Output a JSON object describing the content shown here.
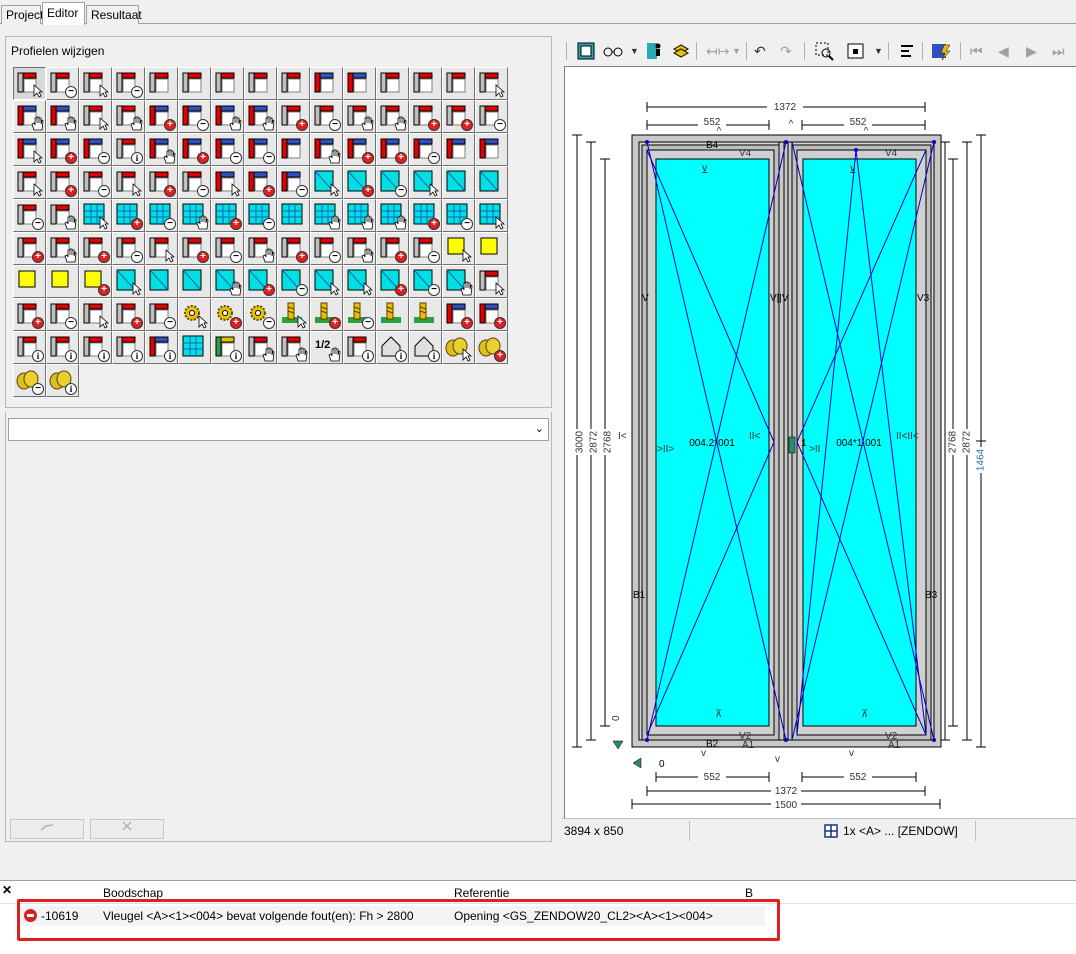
{
  "tabs": [
    {
      "label": "Project",
      "active": false
    },
    {
      "label": "Editor",
      "active": true
    },
    {
      "label": "Resultaat",
      "active": false
    }
  ],
  "left_panel": {
    "title": "Profielen wijzigen",
    "dropdown_value": "",
    "buttons": [
      {
        "icon": "frame-corner-select-icon",
        "badge": "",
        "pointer": true
      },
      {
        "icon": "frame-corner-remove-icon",
        "badge": "minus"
      },
      {
        "icon": "frame-top-select-icon",
        "badge": "",
        "pointer": true
      },
      {
        "icon": "frame-bar-remove-icon",
        "badge": "minus"
      },
      {
        "icon": "profile-edit-icon",
        "badge": ""
      },
      {
        "icon": "profile-type-p-icon",
        "badge": ""
      },
      {
        "icon": "profile-type-p2-icon",
        "badge": ""
      },
      {
        "icon": "profile-type-d-icon",
        "badge": ""
      },
      {
        "icon": "profile-type-e-icon",
        "badge": ""
      },
      {
        "icon": "profile-edit-red-icon",
        "badge": ""
      },
      {
        "icon": "profile-edit-red2-icon",
        "badge": ""
      },
      {
        "icon": "profile-type-v-icon",
        "badge": ""
      },
      {
        "icon": "profile-type-v2-icon",
        "badge": ""
      },
      {
        "icon": "profile-frame-icon",
        "badge": ""
      },
      {
        "icon": "profile-stretch-icon",
        "badge": "",
        "pointer": true
      },
      {
        "icon": "mullion-hand-icon",
        "badge": "",
        "hand": true
      },
      {
        "icon": "mullion-hand2-icon",
        "badge": "",
        "hand": true
      },
      {
        "icon": "diagonal-select-icon",
        "badge": "",
        "pointer": true
      },
      {
        "icon": "diagonal-hand-icon",
        "badge": "",
        "hand": true
      },
      {
        "icon": "sash-add-icon",
        "badge": "plus"
      },
      {
        "icon": "sash-remove-icon",
        "badge": "minus"
      },
      {
        "icon": "mullion-hand3-icon",
        "badge": "",
        "hand": true
      },
      {
        "icon": "mullion-hand4-icon",
        "badge": "",
        "hand": true
      },
      {
        "icon": "transom-add-icon",
        "badge": "plus"
      },
      {
        "icon": "transom-remove-icon",
        "badge": "minus"
      },
      {
        "icon": "transom-hand-icon",
        "badge": "",
        "hand": true
      },
      {
        "icon": "transom-hand2-icon",
        "badge": "",
        "hand": true
      },
      {
        "icon": "bar-add-icon",
        "badge": "plus"
      },
      {
        "icon": "bar-add2-icon",
        "badge": "plus"
      },
      {
        "icon": "bar-remove-icon",
        "badge": "minus"
      },
      {
        "icon": "red-profile-select-icon",
        "badge": "",
        "pointer": true
      },
      {
        "icon": "red-profile-add-icon",
        "badge": "plus"
      },
      {
        "icon": "red-profile-remove-icon",
        "badge": "minus"
      },
      {
        "icon": "arc-info-icon",
        "badge": "info"
      },
      {
        "icon": "dim-x-hand-icon",
        "badge": "",
        "hand": true
      },
      {
        "icon": "dim-x-add-icon",
        "badge": "plus"
      },
      {
        "icon": "dim-x-remove-icon",
        "badge": "minus"
      },
      {
        "icon": "dim-x-minus2-icon",
        "badge": "minus"
      },
      {
        "icon": "dim-x-lock-icon",
        "badge": ""
      },
      {
        "icon": "dim-v-hand-icon",
        "badge": "",
        "hand": true
      },
      {
        "icon": "dim-v-add-icon",
        "badge": "plus"
      },
      {
        "icon": "dim-v-add2-icon",
        "badge": "plus"
      },
      {
        "icon": "dim-v-remove-icon",
        "badge": "minus"
      },
      {
        "icon": "dim-v-lock-icon",
        "badge": ""
      },
      {
        "icon": "dim-v-lock2-icon",
        "badge": ""
      },
      {
        "icon": "frame-copy-select-icon",
        "badge": "",
        "pointer": true
      },
      {
        "icon": "frame-copy-add-icon",
        "badge": "plus"
      },
      {
        "icon": "frame-copy-remove-icon",
        "badge": "minus"
      },
      {
        "icon": "fitting-select-icon",
        "badge": "",
        "pointer": true
      },
      {
        "icon": "fitting-add-icon",
        "badge": "plus"
      },
      {
        "icon": "fitting-remove-icon",
        "badge": "minus"
      },
      {
        "icon": "sash-red-select-icon",
        "badge": "",
        "pointer": true
      },
      {
        "icon": "sash-red-add-icon",
        "badge": "plus"
      },
      {
        "icon": "sash-red-remove-icon",
        "badge": "minus"
      },
      {
        "icon": "glass-select-icon",
        "badge": "",
        "pointer": true
      },
      {
        "icon": "glass-add-icon",
        "badge": "plus"
      },
      {
        "icon": "glass-remove-icon",
        "badge": "minus"
      },
      {
        "icon": "glass-select2-icon",
        "badge": "",
        "pointer": true
      },
      {
        "icon": "glass-split-icon",
        "badge": ""
      },
      {
        "icon": "glass-arrows-icon",
        "badge": ""
      },
      {
        "icon": "muntin-remove-icon",
        "badge": "minus"
      },
      {
        "icon": "muntin-hand-icon",
        "badge": "",
        "hand": true
      },
      {
        "icon": "grid-select-icon",
        "badge": "",
        "pointer": true
      },
      {
        "icon": "grid-add-icon",
        "badge": "plus"
      },
      {
        "icon": "grid-remove-icon",
        "badge": "minus"
      },
      {
        "icon": "grid-hand-icon",
        "badge": "",
        "hand": true
      },
      {
        "icon": "grid-red-add-icon",
        "badge": "plus"
      },
      {
        "icon": "grid-remove2-icon",
        "badge": "minus"
      },
      {
        "icon": "grid-frame-icon",
        "badge": ""
      },
      {
        "icon": "grid-hand2-icon",
        "badge": "",
        "hand": true
      },
      {
        "icon": "grid-hand3-icon",
        "badge": "",
        "hand": true
      },
      {
        "icon": "dots-hand-icon",
        "badge": "",
        "hand": true
      },
      {
        "icon": "dots-add-icon",
        "badge": "plus"
      },
      {
        "icon": "dots-remove-icon",
        "badge": "minus"
      },
      {
        "icon": "dots-select-icon",
        "badge": "",
        "pointer": true
      },
      {
        "icon": "hinge-add-icon",
        "badge": "plus"
      },
      {
        "icon": "hinge-hand-icon",
        "badge": "",
        "hand": true
      },
      {
        "icon": "hinge-add2-icon",
        "badge": "plus"
      },
      {
        "icon": "hinge-remove-icon",
        "badge": "minus"
      },
      {
        "icon": "roll-select-icon",
        "badge": "",
        "pointer": true
      },
      {
        "icon": "roll-add-icon",
        "badge": "plus"
      },
      {
        "icon": "roll-remove-icon",
        "badge": "minus"
      },
      {
        "icon": "handle-hand-icon",
        "badge": "",
        "hand": true
      },
      {
        "icon": "handle-add-icon",
        "badge": "plus"
      },
      {
        "icon": "handle-remove-icon",
        "badge": "minus"
      },
      {
        "icon": "lock-hand-icon",
        "badge": "",
        "hand": true
      },
      {
        "icon": "lock-add-icon",
        "badge": "plus"
      },
      {
        "icon": "lock-remove-icon",
        "badge": "minus"
      },
      {
        "icon": "yellow-select-icon",
        "badge": "",
        "pointer": true
      },
      {
        "icon": "yellow-arrow-icon",
        "badge": ""
      },
      {
        "icon": "yellow-back-icon",
        "badge": ""
      },
      {
        "icon": "yellow-stack-icon",
        "badge": ""
      },
      {
        "icon": "yellow-add-icon",
        "badge": "plus"
      },
      {
        "icon": "door-select-icon",
        "badge": "",
        "pointer": true
      },
      {
        "icon": "door-arrow-icon",
        "badge": ""
      },
      {
        "icon": "door-back-icon",
        "badge": ""
      },
      {
        "icon": "door-hand-icon",
        "badge": "",
        "hand": true
      },
      {
        "icon": "door-add-icon",
        "badge": "plus"
      },
      {
        "icon": "door-remove-icon",
        "badge": "minus"
      },
      {
        "icon": "door-select2-icon",
        "badge": "",
        "pointer": true
      },
      {
        "icon": "leaf-select-icon",
        "badge": "",
        "pointer": true
      },
      {
        "icon": "leaf-add-icon",
        "badge": "plus"
      },
      {
        "icon": "leaf-remove-icon",
        "badge": "minus"
      },
      {
        "icon": "leaf-hand-icon",
        "badge": "",
        "hand": true
      },
      {
        "icon": "seal-select-icon",
        "badge": "",
        "pointer": true
      },
      {
        "icon": "seal-add-icon",
        "badge": "plus"
      },
      {
        "icon": "seal-remove-icon",
        "badge": "minus"
      },
      {
        "icon": "block-select-icon",
        "badge": "",
        "pointer": true
      },
      {
        "icon": "block-add-icon",
        "badge": "plus"
      },
      {
        "icon": "block-remove-icon",
        "badge": "minus"
      },
      {
        "icon": "gear-select-icon",
        "badge": "",
        "pointer": true
      },
      {
        "icon": "gear-add-icon",
        "badge": "plus"
      },
      {
        "icon": "gear-remove-icon",
        "badge": "minus"
      },
      {
        "icon": "screw-select-icon",
        "badge": "",
        "pointer": true
      },
      {
        "icon": "screw-add-icon",
        "badge": "plus"
      },
      {
        "icon": "screw-remove-icon",
        "badge": "minus"
      },
      {
        "icon": "screw-green-icon",
        "badge": ""
      },
      {
        "icon": "screw-green2-icon",
        "badge": ""
      },
      {
        "icon": "corner-red-add-icon",
        "badge": "plus"
      },
      {
        "icon": "corner-red2-add-icon",
        "badge": "plus"
      },
      {
        "icon": "profile-info-icon",
        "badge": "info"
      },
      {
        "icon": "bar-info-icon",
        "badge": "info"
      },
      {
        "icon": "shape-info-icon",
        "badge": "info"
      },
      {
        "icon": "i-beam-x-icon",
        "badge": "info"
      },
      {
        "icon": "i-beam-red-icon",
        "badge": "info"
      },
      {
        "icon": "window-grid-icon",
        "badge": ""
      },
      {
        "icon": "green-arrow-icon",
        "badge": "info"
      },
      {
        "icon": "profile-hand-icon",
        "badge": "",
        "hand": true
      },
      {
        "icon": "film-hand-icon",
        "badge": "",
        "hand": true
      },
      {
        "icon": "half-hand-icon",
        "badge": "",
        "hand": true
      },
      {
        "icon": "frame-info-icon",
        "badge": "info"
      },
      {
        "icon": "cube-info-icon",
        "badge": "info"
      },
      {
        "icon": "house-info-icon",
        "badge": "info"
      },
      {
        "icon": "coins-select-icon",
        "badge": "",
        "pointer": true
      },
      {
        "icon": "coins-add-icon",
        "badge": "plus"
      },
      {
        "icon": "coins-remove-icon",
        "badge": "minus"
      },
      {
        "icon": "coins-info-icon",
        "badge": "info"
      }
    ],
    "disabled_buttons": [
      "check-icon",
      "cross-icon"
    ]
  },
  "right_toolbar": {
    "items": [
      "view-icon",
      "glasses-icon",
      "dropdown-arrow",
      "person-icon",
      "layers-icon",
      "measure-icon",
      "dropdown-arrow",
      "undo-icon",
      "redo-icon",
      "zoom-select-icon",
      "zoom-fit-icon",
      "dropdown-arrow",
      "align-icon",
      "filter-icon",
      "first-icon",
      "prev-icon",
      "next-icon",
      "last-icon"
    ]
  },
  "drawing": {
    "dim_total_width": "1372",
    "dim_left_leaf": "552",
    "dim_right_leaf": "552",
    "dim_bottom_total": "1372",
    "dim_outer_total": "1500",
    "dim_height_outer": "3000",
    "dim_height_2872_left": "2872",
    "dim_height_2768_left": "2768",
    "dim_height_2768_right": "2768",
    "dim_height_2872_right": "2872",
    "dim_height_1464": "1464",
    "label_left_glass": "004.2*001",
    "label_right_glass": "004*1.001",
    "label_b4": "B4",
    "label_v4_left": "V4",
    "label_v4_right": "V4",
    "label_b1": "B1",
    "label_b3": "B3",
    "label_b2": "B2",
    "label_a1_left": "A1",
    "label_a1_right": "A1",
    "label_v2_left": "V2",
    "label_v2_right": "V2",
    "label_v1": "V",
    "label_v3": "V3",
    "label_v_mid": "V||V",
    "label_zero_h": "0",
    "label_zero_v": "0",
    "label_one": "1"
  },
  "status": {
    "size": "3894 x 850",
    "item": "1x <A> ... [ZENDOW]"
  },
  "messages": {
    "col_message": "Boodschap",
    "col_reference": "Referentie",
    "col_b": "B",
    "rows": [
      {
        "code": "-10619",
        "message": "Vleugel <A><1><004> bevat volgende fout(en): Fh > 2800",
        "reference": "Opening <GS_ZENDOW20_CL2><A><1><004>"
      }
    ]
  },
  "colors": {
    "glass": "#00ffff",
    "frame": "#c0c0c0",
    "error": "#d42020",
    "highlight": "#e02020",
    "line": "#0000cc"
  }
}
